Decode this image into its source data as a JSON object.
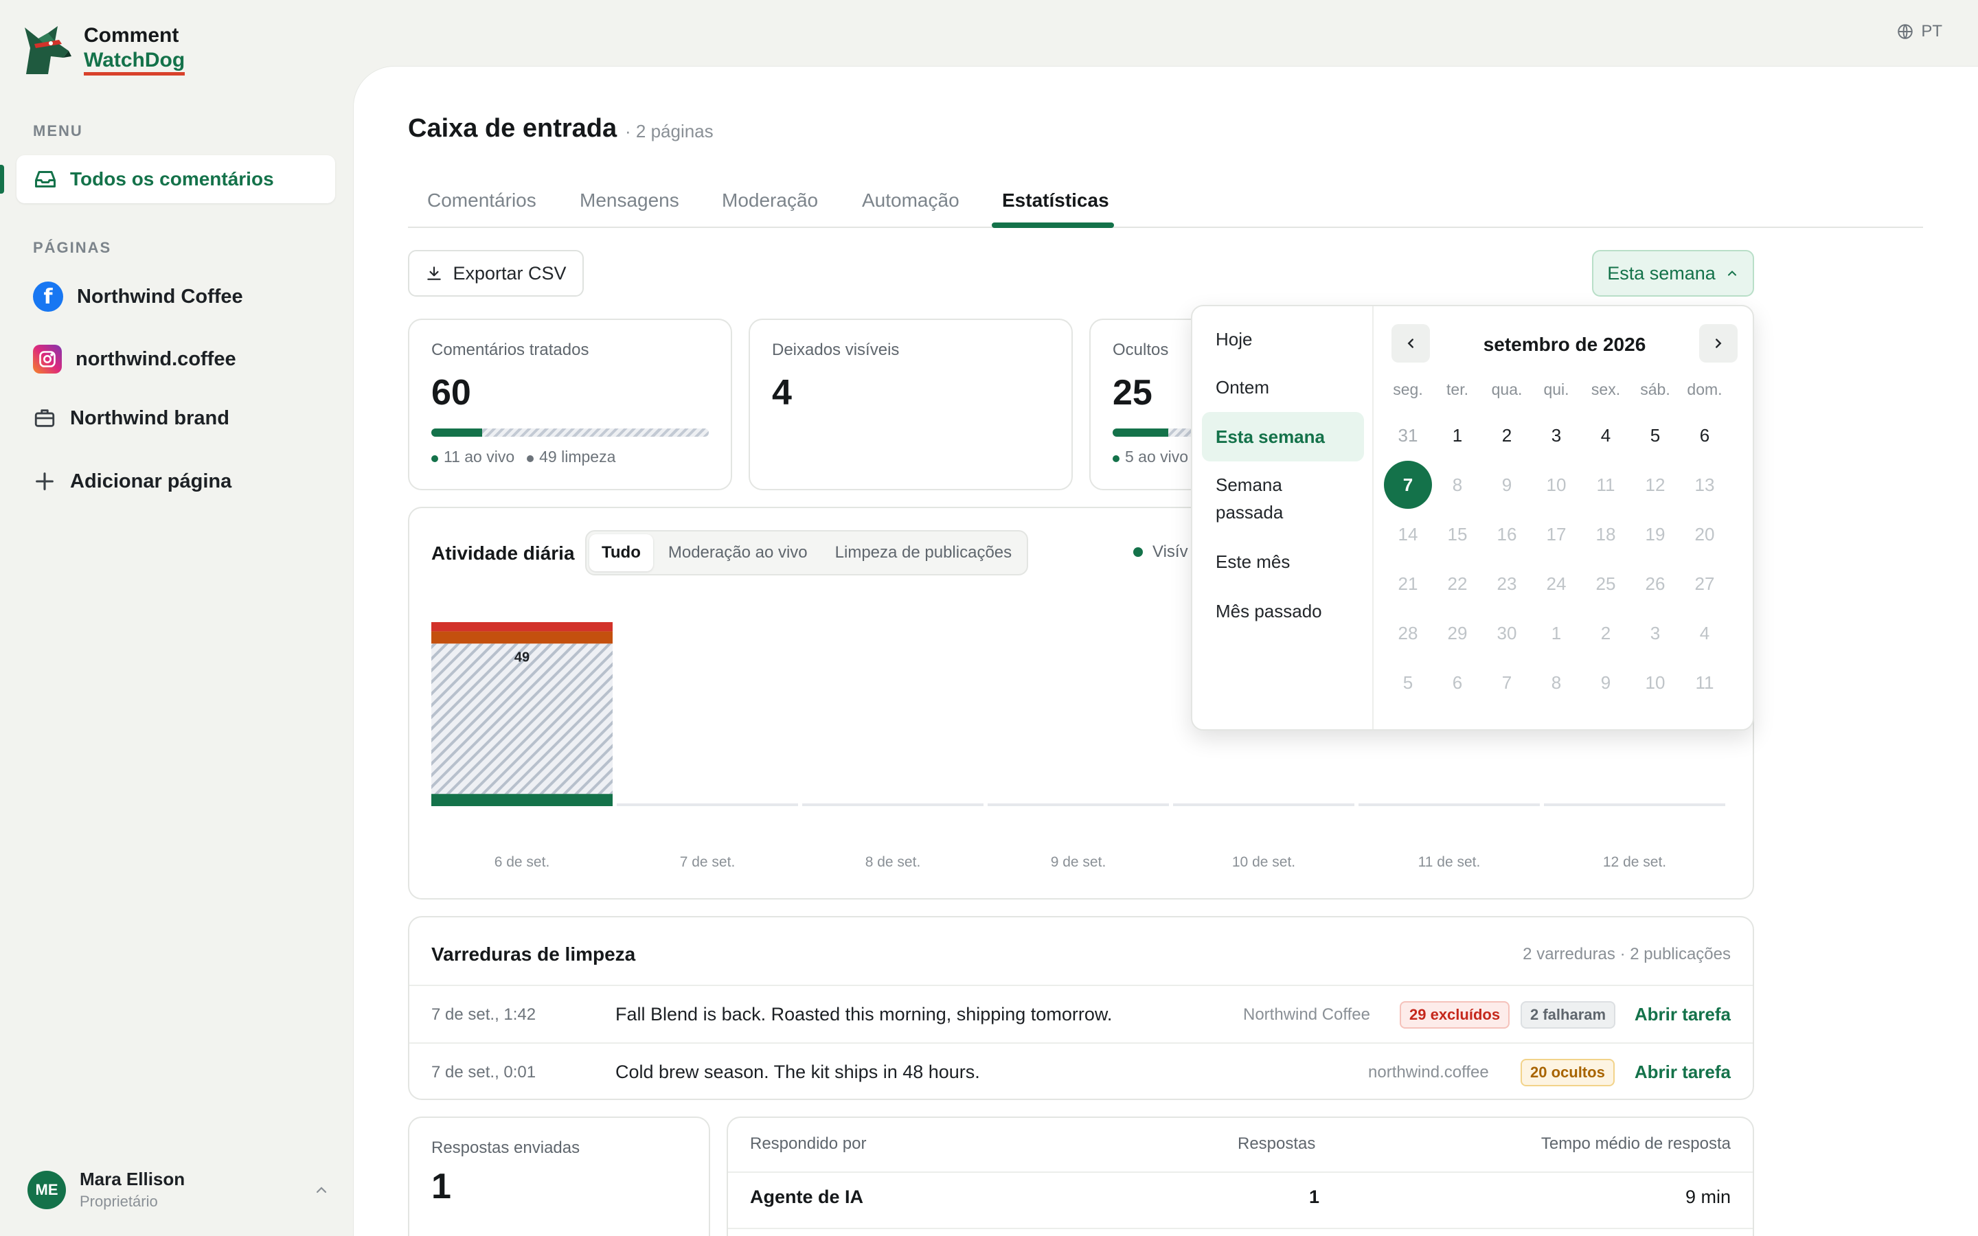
{
  "app": {
    "name_line1": "Comment",
    "name_line2": "WatchDog",
    "language": "PT"
  },
  "sidebar": {
    "menu_label": "MENU",
    "active_item": "Todos os comentários",
    "pages_label": "PÁGINAS",
    "pages": [
      {
        "label": "Northwind Coffee",
        "icon": "facebook-icon"
      },
      {
        "label": "northwind.coffee",
        "icon": "instagram-icon"
      },
      {
        "label": "Northwind brand",
        "icon": "briefcase-icon"
      }
    ],
    "add_page": "Adicionar página",
    "user": {
      "initials": "ME",
      "name": "Mara Ellison",
      "role": "Proprietário"
    }
  },
  "header": {
    "title": "Caixa de entrada",
    "subtitle": "· 2 páginas"
  },
  "tabs": [
    "Comentários",
    "Mensagens",
    "Moderação",
    "Automação",
    "Estatísticas"
  ],
  "active_tab": "Estatísticas",
  "toolbar": {
    "export": "Exportar CSV",
    "range": "Esta semana"
  },
  "stats": [
    {
      "label": "Comentários tratados",
      "value": "60",
      "bar_fraction": 0.183,
      "legend": [
        "11 ao vivo",
        "49 limpeza"
      ]
    },
    {
      "label": "Deixados visíveis",
      "value": "4"
    },
    {
      "label": "Ocultos",
      "value": "25",
      "bar_fraction": 0.2,
      "legend": [
        "5 ao vivo"
      ]
    }
  ],
  "activity": {
    "title": "Atividade diária",
    "filters": [
      "Tudo",
      "Moderação ao vivo",
      "Limpeza de publicações"
    ],
    "active_filter": "Tudo",
    "legend_partial": "Visív",
    "colors": {
      "visible": "#14724a",
      "orange": "#c4500e",
      "red": "#d2322a",
      "cleanup": "#c3cad4"
    }
  },
  "chart_data": {
    "type": "bar",
    "stacked": true,
    "categories": [
      "6 de set.",
      "7 de set.",
      "8 de set.",
      "9 de set.",
      "10 de set.",
      "11 de set.",
      "12 de set."
    ],
    "series": [
      {
        "name": "Visíveis",
        "values": [
          4,
          0,
          0,
          0,
          0,
          0,
          0
        ]
      },
      {
        "values": [
          49,
          0,
          0,
          0,
          0,
          0,
          0
        ]
      },
      {
        "values": [
          4,
          0,
          0,
          0,
          0,
          0,
          0
        ]
      },
      {
        "values": [
          3,
          0,
          0,
          0,
          0,
          0,
          0
        ]
      }
    ],
    "data_labels": [
      "49"
    ]
  },
  "sweeps": {
    "title": "Varreduras de limpeza",
    "meta": "2 varreduras · 2 publicações",
    "rows": [
      {
        "date": "7 de set., 1:42",
        "message": "Fall Blend is back. Roasted this morning, shipping tomorrow.",
        "page": "Northwind Coffee",
        "badges": [
          "29 excluídos",
          "2 falharam"
        ],
        "action": "Abrir tarefa"
      },
      {
        "date": "7 de set., 0:01",
        "message": "Cold brew season. The kit ships in 48 hours.",
        "page": "northwind.coffee",
        "badges": [
          "20 ocultos"
        ],
        "action": "Abrir tarefa"
      }
    ]
  },
  "replies": {
    "label": "Respostas enviadas",
    "value": "1"
  },
  "responders": {
    "headers": [
      "Respondido por",
      "Respostas",
      "Tempo médio de resposta"
    ],
    "rows": [
      {
        "by": "Agente de IA",
        "count": "1",
        "avg": "9 min"
      }
    ]
  },
  "date_picker": {
    "presets": [
      "Hoje",
      "Ontem",
      "Esta semana",
      "Semana passada",
      "Este mês",
      "Mês passado"
    ],
    "active_preset": "Esta semana",
    "month": "setembro de 2026",
    "weekdays": [
      "seg.",
      "ter.",
      "qua.",
      "qui.",
      "sex.",
      "sáb.",
      "dom."
    ],
    "days": [
      [
        "31",
        "1",
        "2",
        "3",
        "4",
        "5",
        "6"
      ],
      [
        "7",
        "8",
        "9",
        "10",
        "11",
        "12",
        "13"
      ],
      [
        "14",
        "15",
        "16",
        "17",
        "18",
        "19",
        "20"
      ],
      [
        "21",
        "22",
        "23",
        "24",
        "25",
        "26",
        "27"
      ],
      [
        "28",
        "29",
        "30",
        "1",
        "2",
        "3",
        "4"
      ],
      [
        "5",
        "6",
        "7",
        "8",
        "9",
        "10",
        "11"
      ]
    ],
    "selected_day": "7"
  }
}
